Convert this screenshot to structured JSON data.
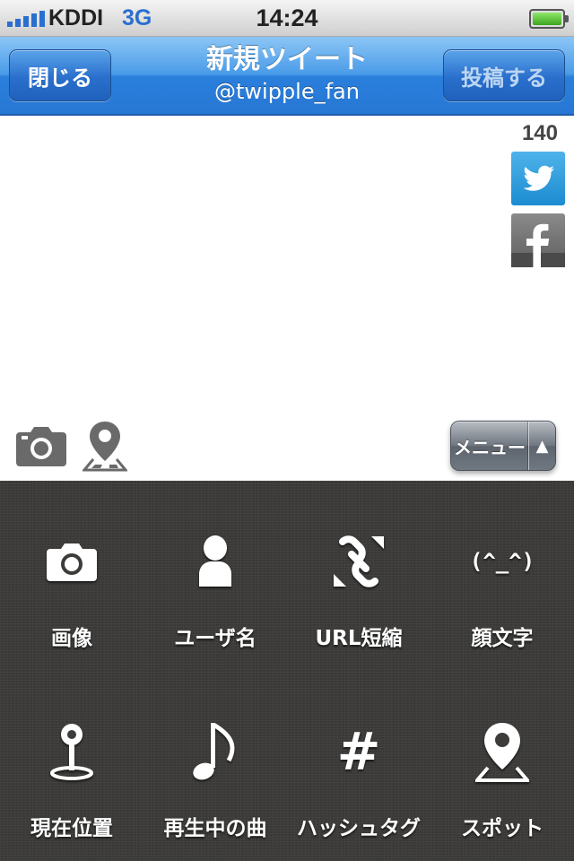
{
  "status_bar": {
    "carrier": "KDDI",
    "network": "3G",
    "time": "14:24"
  },
  "nav": {
    "close_label": "閉じる",
    "title": "新規ツイート",
    "account": "@twipple_fan",
    "post_label": "投稿する"
  },
  "compose": {
    "char_count": "140",
    "menu_toggle_label": "メニュー",
    "menu_toggle_arrow": "▲"
  },
  "menu": {
    "items": [
      {
        "label": "画像",
        "icon": "camera-icon"
      },
      {
        "label": "ユーザ名",
        "icon": "user-icon"
      },
      {
        "label": "URL短縮",
        "icon": "link-shorten-icon"
      },
      {
        "label": "顔文字",
        "icon": "emoticon-icon",
        "icon_text": "(^_^)"
      },
      {
        "label": "現在位置",
        "icon": "current-location-icon"
      },
      {
        "label": "再生中の曲",
        "icon": "music-note-icon"
      },
      {
        "label": "ハッシュタグ",
        "icon": "hashtag-icon",
        "icon_text": "#"
      },
      {
        "label": "スポット",
        "icon": "spot-pin-icon"
      }
    ]
  },
  "colors": {
    "nav_blue": "#2a7fdc",
    "panel_bg": "#3d3c3a",
    "twitter_blue": "#1b8bd1"
  }
}
